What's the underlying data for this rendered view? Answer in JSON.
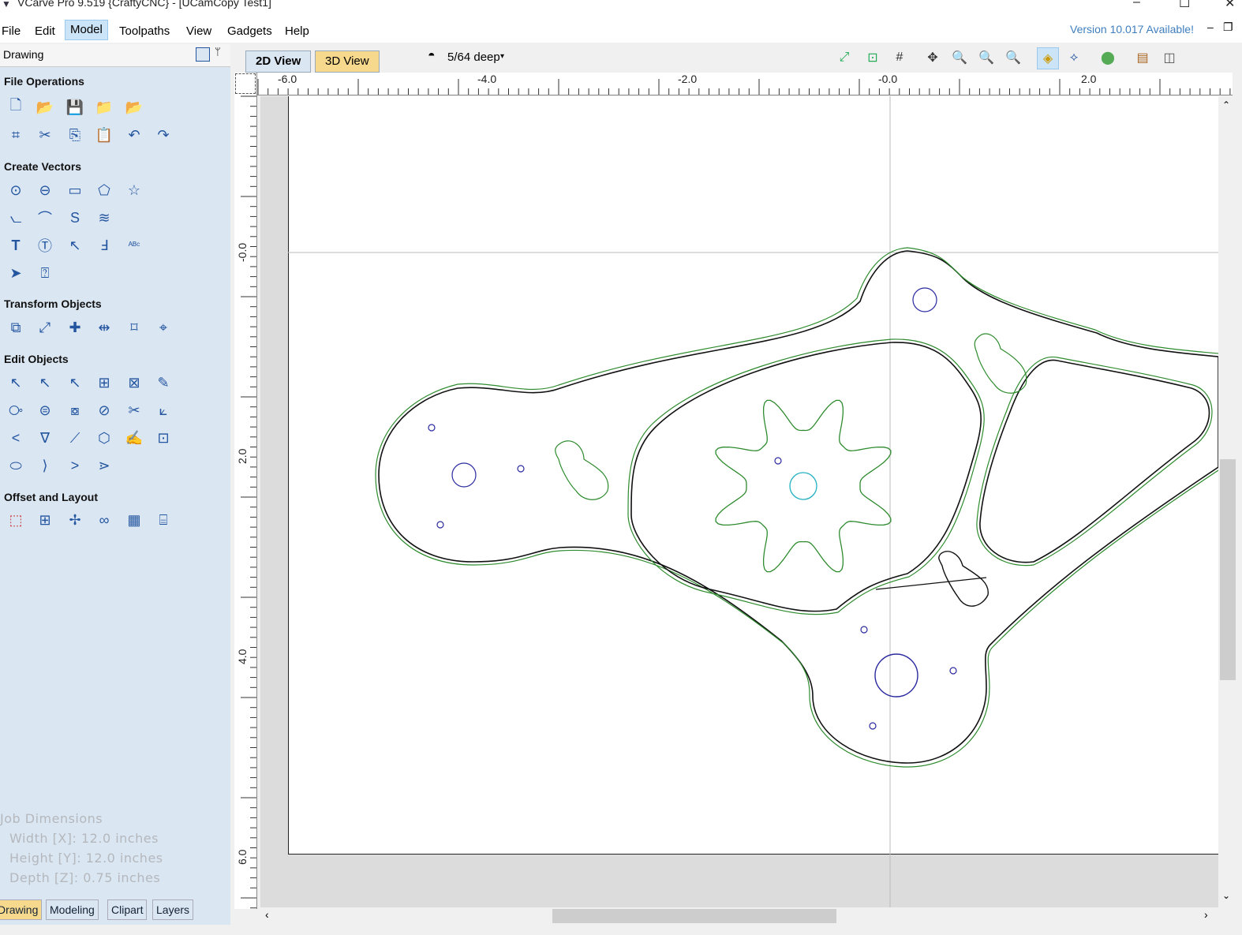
{
  "window": {
    "title": "VCarve Pro 9.519 {CraftyCNC} - [UCamCopy Test1]",
    "minimize": "–",
    "maximize": "☐",
    "close": "✕"
  },
  "menu": [
    "File",
    "Edit",
    "Model",
    "Toolpaths",
    "View",
    "Gadgets",
    "Help"
  ],
  "version_notice": "Version 10.017 Available!",
  "panel": {
    "title": "Drawing",
    "sections": {
      "file_operations": "File Operations",
      "create_vectors": "Create Vectors",
      "transform_objects": "Transform Objects",
      "edit_objects": "Edit Objects",
      "offset_layout": "Offset and Layout"
    },
    "job_dimensions": {
      "title": "Job Dimensions",
      "width": "Width  [X]: 12.0 inches",
      "height": "Height [Y]: 12.0 inches",
      "depth": "Depth  [Z]: 0.75 inches"
    },
    "tabs": [
      "Drawing",
      "Modeling",
      "Clipart",
      "Layers"
    ]
  },
  "view": {
    "tab_2d": "2D View",
    "tab_3d": "3D View",
    "depth_label": "5/64 deep",
    "ruler_top": [
      "-6.0",
      "-4.0",
      "-2.0",
      "-0.0",
      "2.0"
    ],
    "ruler_left": [
      "-0.0",
      "2.0",
      "4.0",
      "6.0"
    ]
  },
  "colors": {
    "panel_bg": "#dbe6f3",
    "vector_green": "#2e8b2e",
    "vector_black": "#111111",
    "hole_blue": "#2a2aa0",
    "center_cyan": "#20b0c0",
    "version_link": "#3f7fbf"
  }
}
